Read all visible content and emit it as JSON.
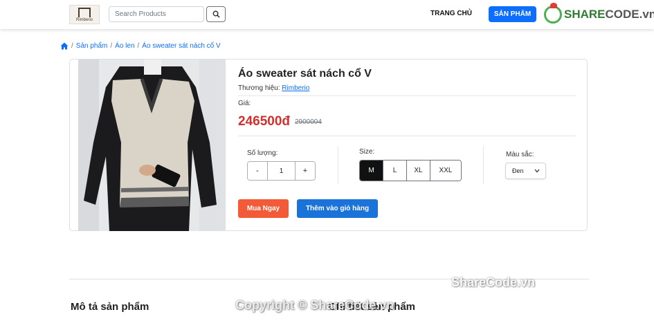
{
  "header": {
    "logo_text": "Rimberio",
    "search_placeholder": "Search Products",
    "nav_home": "TRANG CHỦ",
    "nav_products": "SẢN PHẨM",
    "watermark_share": "SHARE",
    "watermark_code": "CODE.vn"
  },
  "breadcrumb": {
    "items": [
      "Sản phẩm",
      "Áo len",
      "Áo sweater sát nách cổ V"
    ]
  },
  "product": {
    "title": "Áo sweater sát nách cổ V",
    "brand_label": "Thương hiệu:",
    "brand_name": "Rimberio",
    "price_label": "Giá:",
    "price": "246500đ",
    "old_price": "2900004",
    "quantity_label": "Số lượng:",
    "quantity_minus": "-",
    "quantity_value": "1",
    "quantity_plus": "+",
    "size_label": "Size:",
    "sizes": [
      "M",
      "L",
      "XL",
      "XXL"
    ],
    "selected_size": "M",
    "color_label": "Màu sắc:",
    "color_value": "Đen",
    "buy_now": "Mua Ngay",
    "add_to_cart": "Thêm vào giỏ hàng"
  },
  "sections": {
    "description_title": "Mô tả sản phẩm",
    "detail_title": "Chi tiết sản phẩm"
  },
  "watermarks": {
    "middle": "ShareCode.vn",
    "copyright": "Copyright © ShareCode.vn"
  },
  "colors": {
    "primary": "#0d6efd",
    "price": "#d32f2f",
    "buy_now": "#f25a38",
    "add_cart": "#1a73d9"
  }
}
